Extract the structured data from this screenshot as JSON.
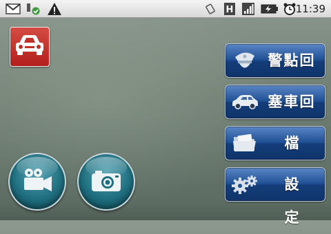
{
  "status_bar": {
    "time": "11:39",
    "icons": [
      "gmail-icon",
      "usb-debug-icon",
      "warning-icon",
      "vibrate-icon",
      "h-data-icon",
      "signal-icon",
      "battery-charging-icon",
      "alarm-icon"
    ]
  },
  "app": {
    "icon_name": "car-icon"
  },
  "menu": [
    {
      "label": "警點回報",
      "icon": "police-cap-icon"
    },
    {
      "label": "塞車回報",
      "icon": "car-icon"
    },
    {
      "label": "檔案",
      "icon": "folder-icon"
    },
    {
      "label": "設定",
      "icon": "gears-icon"
    }
  ],
  "round_buttons": [
    {
      "icon": "video-camera-icon"
    },
    {
      "icon": "camera-icon"
    }
  ],
  "colors": {
    "button_blue": "#1f4f95",
    "app_red": "#c0302b",
    "round_teal": "#1f6f80"
  }
}
